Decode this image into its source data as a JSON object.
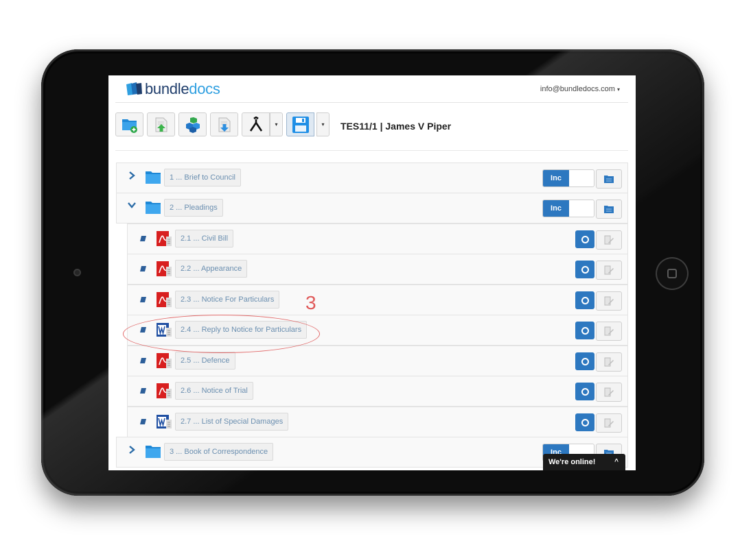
{
  "app": {
    "logo_part1": "bundle",
    "logo_part2": "docs",
    "user_menu": "info@bundledocs.com",
    "user_menu_caret": "▾",
    "document_title": "TES11/1 | James V Piper"
  },
  "toolbar": {
    "buttons": [
      {
        "name": "add-section",
        "icon": "folder-add-icon"
      },
      {
        "name": "upload-document",
        "icon": "upload-icon"
      },
      {
        "name": "add-blocks",
        "icon": "blocks-icon"
      },
      {
        "name": "download",
        "icon": "download-icon"
      },
      {
        "name": "merge",
        "icon": "merge-icon"
      },
      {
        "name": "save",
        "icon": "floppy-disk-icon"
      }
    ],
    "caret": "▾"
  },
  "tree": {
    "inc_label": "Inc",
    "folders": [
      {
        "label": "1 ... Brief to Council",
        "expanded": false,
        "included": true
      },
      {
        "label": "2 ... Pleadings",
        "expanded": true,
        "included": true
      },
      {
        "label": "3 ... Book of Correspondence",
        "expanded": false,
        "included": true
      }
    ],
    "documents": [
      {
        "label": "2.1 ... Civil Bill",
        "type": "pdf"
      },
      {
        "label": "2.2 ... Appearance",
        "type": "pdf"
      },
      {
        "label": "2.3 ... Notice For Particulars",
        "type": "pdf"
      },
      {
        "label": "2.4 ... Reply to Notice for Particulars",
        "type": "word"
      },
      {
        "label": "2.5 ... Defence",
        "type": "pdf"
      },
      {
        "label": "2.6 ... Notice of Trial",
        "type": "pdf"
      },
      {
        "label": "2.7 ... List of Special Damages",
        "type": "word"
      }
    ]
  },
  "annotation": {
    "number": "3",
    "color": "#e05a5a"
  },
  "chat": {
    "label": "We're online!",
    "toggle": "^"
  },
  "colors": {
    "accent": "#2d78c0",
    "brand_dark": "#1f3d6b",
    "brand_light": "#2f9fe0",
    "label_text": "#6b8fb0"
  }
}
